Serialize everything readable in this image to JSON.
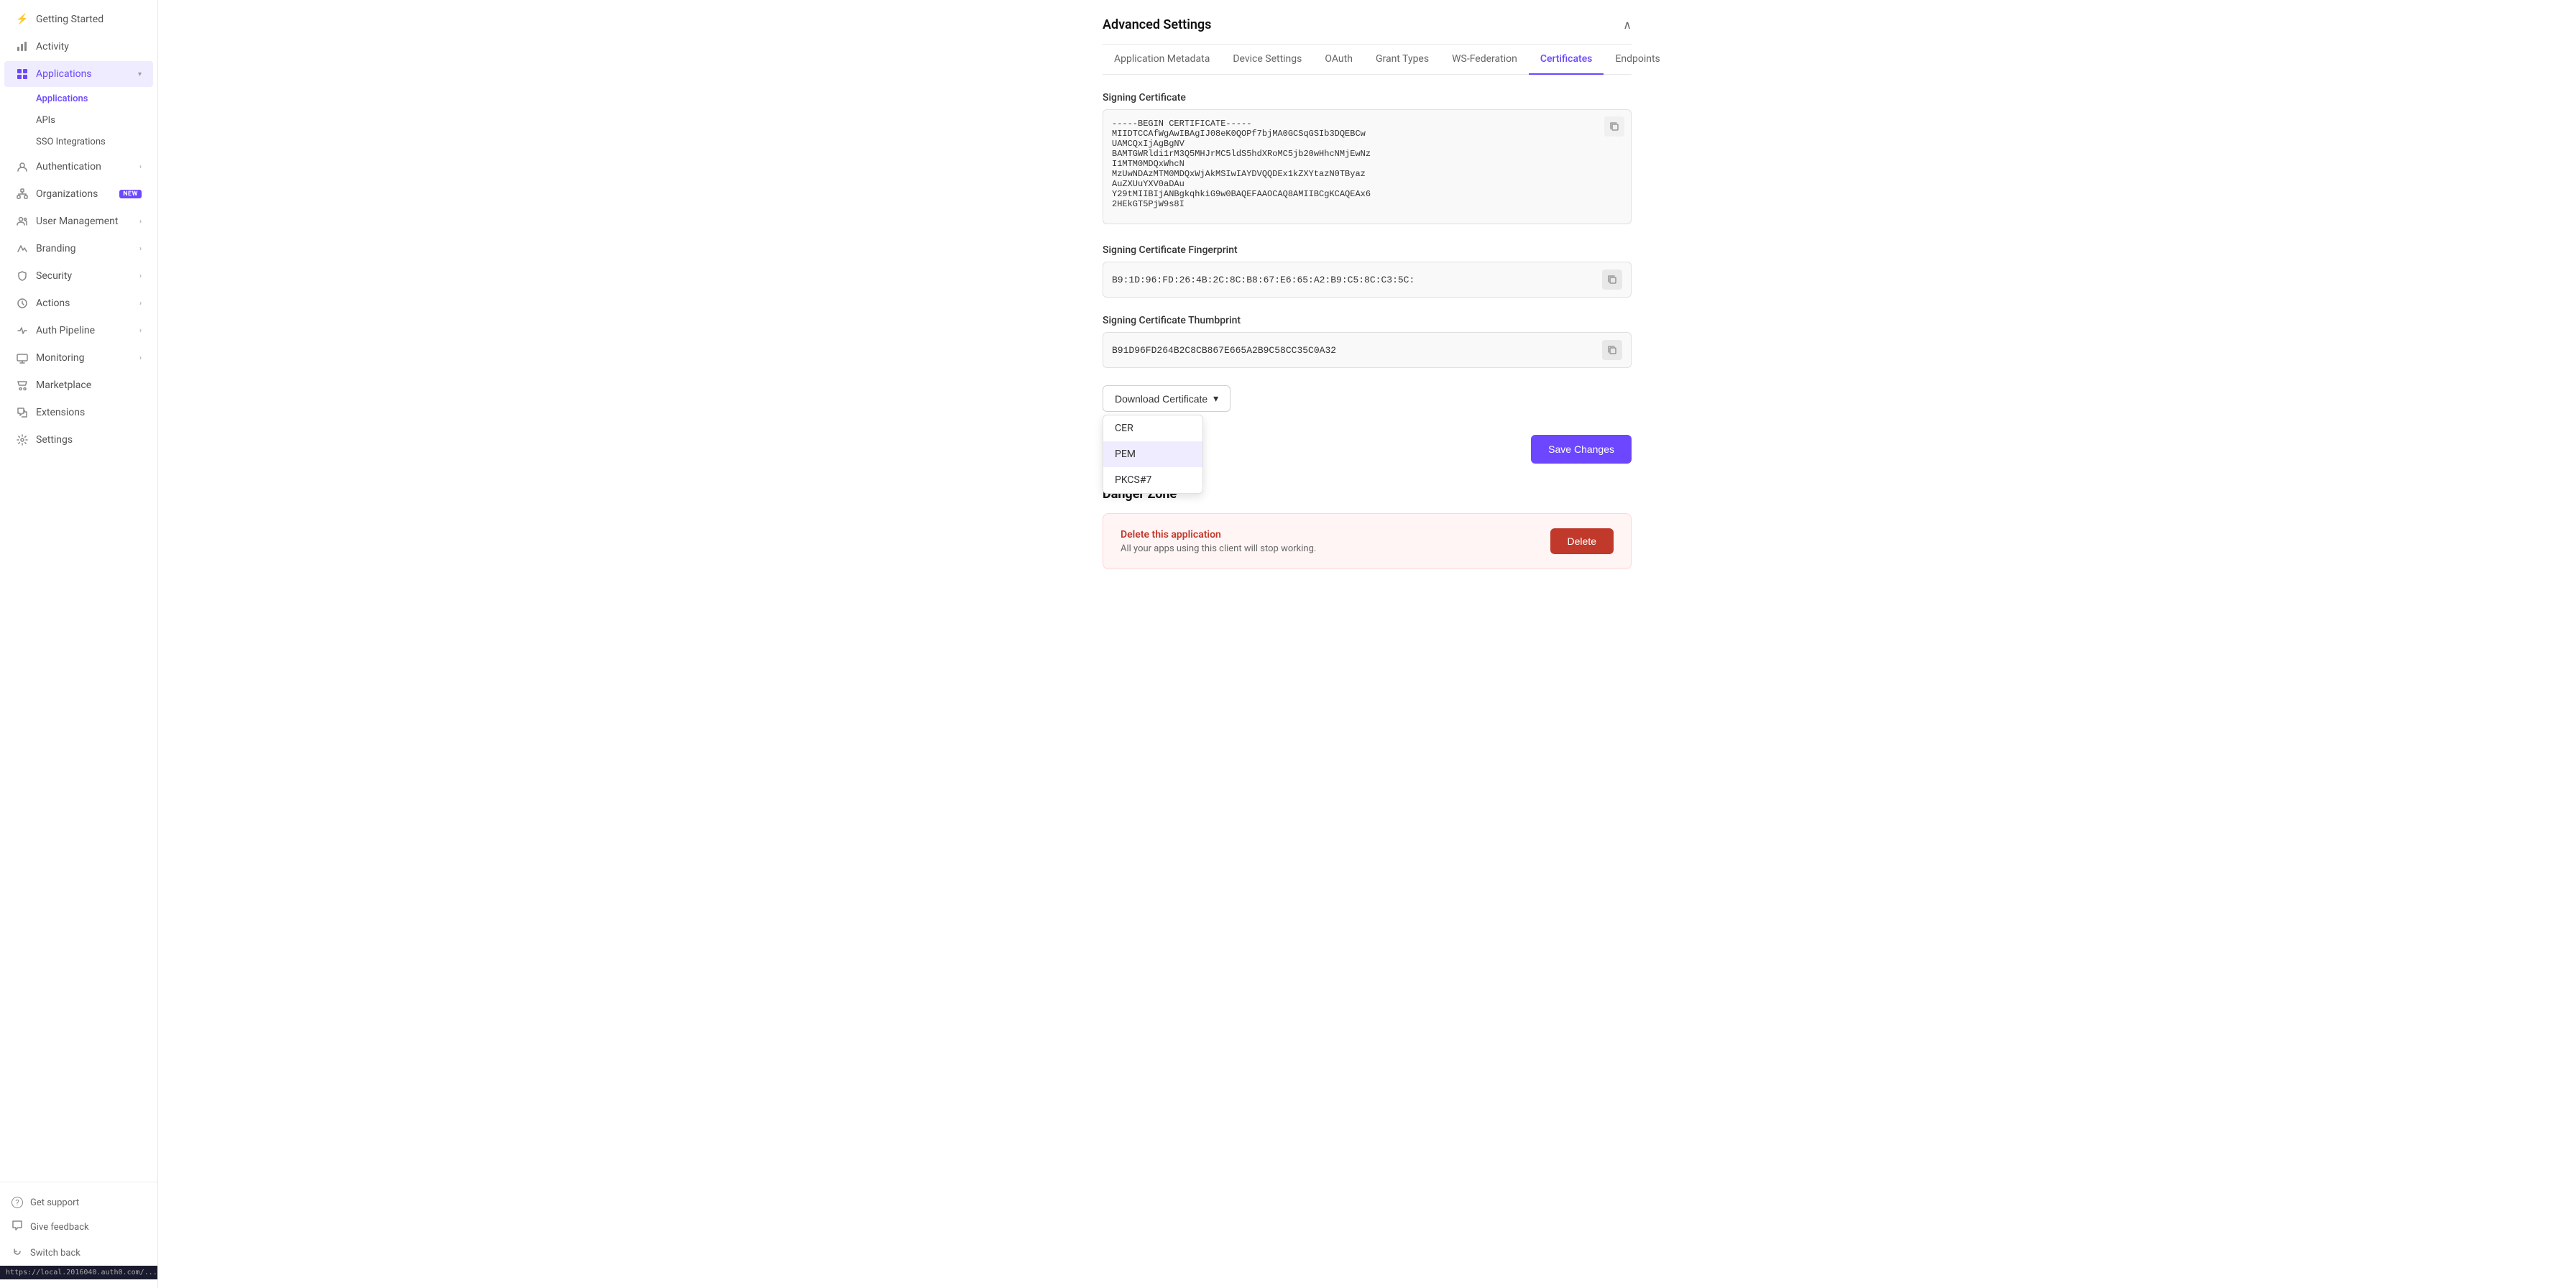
{
  "sidebar": {
    "items": [
      {
        "id": "getting-started",
        "label": "Getting Started",
        "icon": "⚡",
        "active": false,
        "hasChevron": false,
        "badge": null
      },
      {
        "id": "activity",
        "label": "Activity",
        "icon": "📊",
        "active": false,
        "hasChevron": false,
        "badge": null
      },
      {
        "id": "applications",
        "label": "Applications",
        "icon": "🔳",
        "active": true,
        "hasChevron": true,
        "badge": null
      },
      {
        "id": "authentication",
        "label": "Authentication",
        "icon": "👤",
        "active": false,
        "hasChevron": true,
        "badge": null
      },
      {
        "id": "organizations",
        "label": "Organizations",
        "icon": "🏢",
        "active": false,
        "hasChevron": false,
        "badge": "NEW"
      },
      {
        "id": "user-management",
        "label": "User Management",
        "icon": "👥",
        "active": false,
        "hasChevron": true,
        "badge": null
      },
      {
        "id": "branding",
        "label": "Branding",
        "icon": "🖊",
        "active": false,
        "hasChevron": true,
        "badge": null
      },
      {
        "id": "security",
        "label": "Security",
        "icon": "🛡",
        "active": false,
        "hasChevron": true,
        "badge": null
      },
      {
        "id": "actions",
        "label": "Actions",
        "icon": "⚙",
        "active": false,
        "hasChevron": true,
        "badge": null
      },
      {
        "id": "auth-pipeline",
        "label": "Auth Pipeline",
        "icon": "🔗",
        "active": false,
        "hasChevron": true,
        "badge": null
      },
      {
        "id": "monitoring",
        "label": "Monitoring",
        "icon": "📈",
        "active": false,
        "hasChevron": true,
        "badge": null
      },
      {
        "id": "marketplace",
        "label": "Marketplace",
        "icon": "🛒",
        "active": false,
        "hasChevron": false,
        "badge": null
      },
      {
        "id": "extensions",
        "label": "Extensions",
        "icon": "🧩",
        "active": false,
        "hasChevron": false,
        "badge": null
      },
      {
        "id": "settings",
        "label": "Settings",
        "icon": "⚙",
        "active": false,
        "hasChevron": false,
        "badge": null
      }
    ],
    "sub_items": [
      {
        "id": "applications-sub",
        "label": "Applications",
        "active": true
      },
      {
        "id": "apis-sub",
        "label": "APIs",
        "active": false
      },
      {
        "id": "sso-integrations-sub",
        "label": "SSO Integrations",
        "active": false
      }
    ],
    "bottom_items": [
      {
        "id": "get-support",
        "label": "Get support",
        "icon": "?"
      },
      {
        "id": "give-feedback",
        "label": "Give feedback",
        "icon": "💬"
      },
      {
        "id": "switch-back",
        "label": "Switch back",
        "icon": "↩"
      }
    ],
    "url": "https://local.2016040.auth0.com/..."
  },
  "advanced_settings": {
    "title": "Advanced Settings",
    "tabs": [
      {
        "id": "application-metadata",
        "label": "Application Metadata",
        "active": false
      },
      {
        "id": "device-settings",
        "label": "Device Settings",
        "active": false
      },
      {
        "id": "oauth",
        "label": "OAuth",
        "active": false
      },
      {
        "id": "grant-types",
        "label": "Grant Types",
        "active": false
      },
      {
        "id": "ws-federation",
        "label": "WS-Federation",
        "active": false
      },
      {
        "id": "certificates",
        "label": "Certificates",
        "active": true
      },
      {
        "id": "endpoints",
        "label": "Endpoints",
        "active": false
      }
    ],
    "signing_certificate": {
      "label": "Signing Certificate",
      "value": "-----BEGIN CERTIFICATE-----\nMIIDTCCAfWgAwIBAgIJ08eK0QOPf7bjMA0GCSqGSIb3DQEBCw\nUAMCQxIjAgBgNV\nBAMTGWR1di1rM3Q5MHJrMC5ldS5hdXRoMC5jb20wHhcNMjEwNz\nI1MTM0MDQxWhcN\nMzUwNDAzMTM0MDQxWjAkMSIwIAYDVQQDEx1kZXYtazN0TByaz\nAuZXUuYXV0aDAu\nY29tMIIBIjANBgkqhkiG9w0BAQEFAAOCAQ8AMIIBCgKCAQEAx6\n2HEkGT5PjW9s8I"
    },
    "signing_certificate_fingerprint": {
      "label": "Signing Certificate Fingerprint",
      "value": "B9:1D:96:FD:26:4B:2C:8C:B8:67:E6:65:A2:B9:C5:8C:C3:5C:"
    },
    "signing_certificate_thumbprint": {
      "label": "Signing Certificate Thumbprint",
      "value": "B91D96FD264B2C8CB867E665A2B9C58CC35C0A32"
    },
    "download_certificate": {
      "label": "Download Certificate",
      "options": [
        {
          "id": "cer",
          "label": "CER"
        },
        {
          "id": "pem",
          "label": "PEM",
          "highlighted": true
        },
        {
          "id": "pkcs7",
          "label": "PKCS#7"
        }
      ]
    },
    "save_button_label": "Save Changes"
  },
  "danger_zone": {
    "title": "Danger Zone",
    "delete_app": {
      "title": "Delete this application",
      "description": "All your apps using this client will stop working.",
      "button_label": "Delete"
    }
  }
}
